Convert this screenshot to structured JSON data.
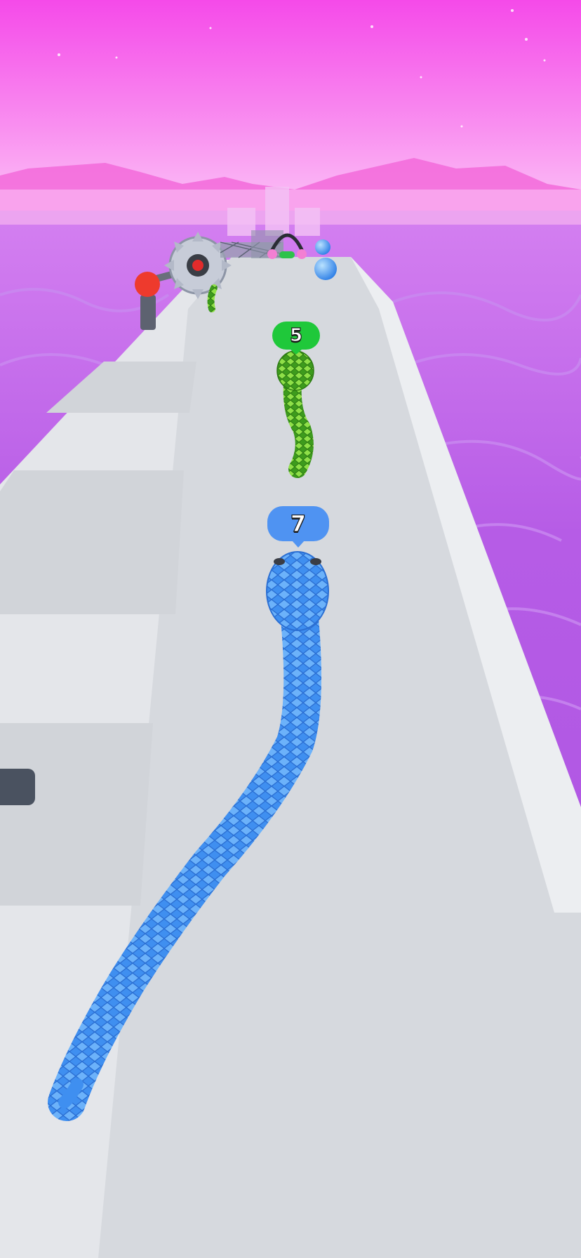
{
  "hud": {
    "player_snake_length": "7",
    "enemy_snake_length": "5"
  },
  "scene": {
    "sky_colors": [
      "#f54ae9",
      "#f9a4f2"
    ],
    "lava_color": "#b65ce6",
    "road_color": "#d6d9de",
    "player_snake_color": "#3f8ff0",
    "enemy_snake_color": "#5fc32c",
    "badge_player_color": "#4f93f2",
    "badge_enemy_color": "#1fc83a",
    "obstacles": [
      "spinning-saw-blade",
      "red-lever",
      "net-gate",
      "blue-orb"
    ]
  }
}
